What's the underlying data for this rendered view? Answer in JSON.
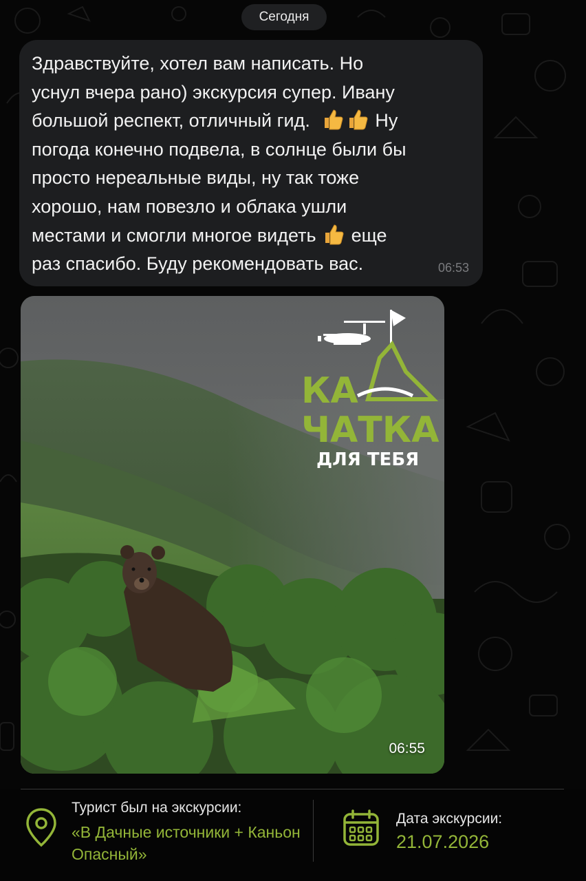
{
  "chat": {
    "date_label": "Сегодня",
    "message": {
      "lines": [
        "Здравствуйте, хотел вам написать. Но",
        "уснул вчера рано) экскурсия супер. Ивану",
        "большой респект, отличный гид.",
        "Ну",
        "погода конечно подвела, в солнце были бы",
        "просто нереальные виды, ну так тоже",
        "хорошо, нам повезло и облака ушли",
        "местами и смогли многое видеть",
        "еще",
        "раз спасибо. Буду рекомендовать вас."
      ],
      "time": "06:53",
      "emoji": "thumbs-up"
    },
    "photo_message": {
      "time": "06:55",
      "logo_line1": "КА",
      "logo_line2": "ЧАТКА",
      "logo_line3": "ДЛЯ ТЕБЯ"
    }
  },
  "info": {
    "tour_label": "Турист был на экскурсии:",
    "tour_name": "«В Дачные источники + Каньон Опасный»",
    "date_label": "Дата экскурсии:",
    "date_value": "21.07.2026",
    "accent_color": "#93b538"
  }
}
